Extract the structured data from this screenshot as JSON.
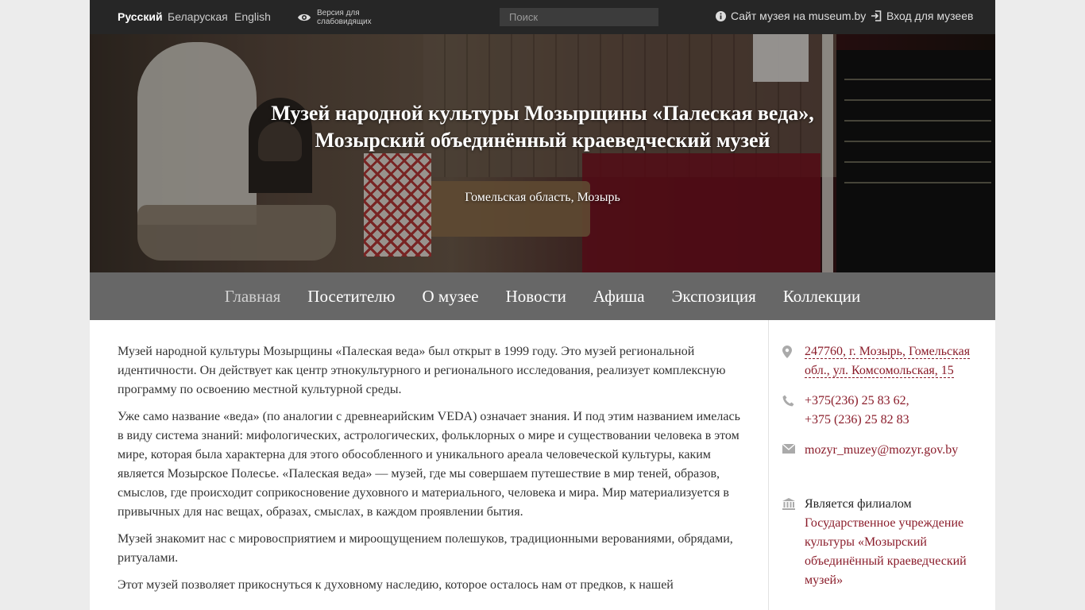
{
  "topbar": {
    "languages": [
      "Русский",
      "Беларуская",
      "English"
    ],
    "vision_label": "Версия для слабовидящих",
    "search_placeholder": "Поиск",
    "museum_site_link": "Сайт музея на museum.by",
    "login_link": "Вход для музеев"
  },
  "hero": {
    "title": "Музей народной культуры Мозырщины «Палеская веда», Мозырский объединённый краеведческий музей",
    "subtitle": "Гомельская область, Мозырь"
  },
  "nav": {
    "items": [
      "Главная",
      "Посетителю",
      "О музее",
      "Новости",
      "Афиша",
      "Экспозиция",
      "Коллекции"
    ],
    "active": "Главная"
  },
  "main": {
    "paragraphs": [
      "Музей народной культуры Мозырщины «Палеская веда» был открыт в 1999 году. Это музей региональной идентичности. Он действует как центр этнокультурного и регионального исследования, реализует комплексную программу по освоению местной культурной среды.",
      "Уже само название «веда» (по аналогии с древнеарийским VEDA) означает знания. И под этим названием имелась в виду система знаний: мифологических, астрологических, фольклорных о мире и существовании человека в этом мире, которая была характерна для этого обособленного и уникального ареала человеческой культуры, каким является Мозырское Полесье. «Палеская веда» — музей, где мы совершаем путешествие в мир теней, образов, смыслов, где происходит соприкосновение духовного и материального, человека и мира. Мир материализуется в привычных для нас вещах, образах, смыслах, в каждом проявлении бытия.",
      "Музей знакомит нас с мировосприятием и мироощущением полешуков, традиционными верованиями, обрядами, ритуалами.",
      "Этот музей позволяет прикоснуться к духовному наследию, которое осталось нам от предков, к нашей"
    ]
  },
  "sidebar": {
    "address": "247760, г. Мозырь, Гомельская обл., ул. Комсомольская, 15",
    "phone1": "+375(236) 25 83 62,",
    "phone2": "+375 (236) 25 82 83",
    "email": "mozyr_muzey@mozyr.gov.by",
    "branch_label": "Является филиалом",
    "branch_org": "Государственное учреждение культуры «Мозырский объединённый краеведческий музей»"
  },
  "colors": {
    "topbar_bg": "#262626",
    "nav_bg": "#676767",
    "link": "#8a1c2a"
  }
}
